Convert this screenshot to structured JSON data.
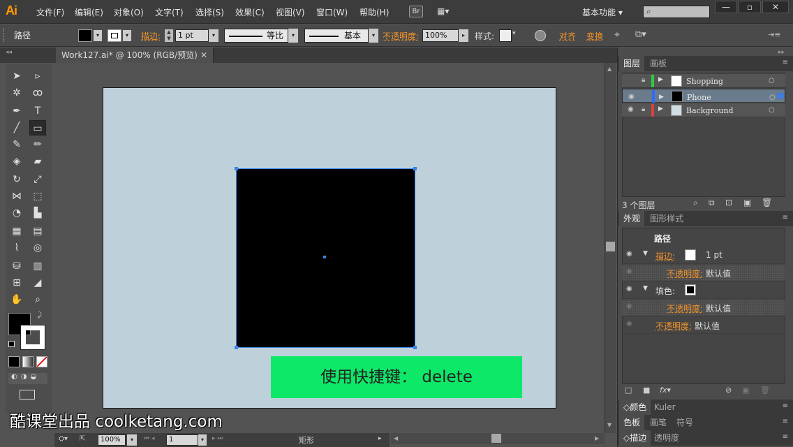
{
  "app": {
    "logo": "Ai",
    "workspace": "基本功能",
    "search_placeholder": ""
  },
  "menu": [
    "文件(F)",
    "编辑(E)",
    "对象(O)",
    "文字(T)",
    "选择(S)",
    "效果(C)",
    "视图(V)",
    "窗口(W)",
    "帮助(H)"
  ],
  "bridge_label": "Br",
  "control": {
    "selection_type": "路径",
    "stroke_label": "描边:",
    "stroke_weight": "1 pt",
    "profile_label": "等比",
    "brush_label": "基本",
    "opacity_label": "不透明度:",
    "opacity_value": "100%",
    "style_label": "样式:",
    "align_label": "对齐",
    "transform_label": "变换"
  },
  "document": {
    "tab_title": "Work127.ai* @ 100% (RGB/预览)"
  },
  "canvas": {
    "shortcut_text": "使用快捷键： delete",
    "watermark": "酷课堂出品 coolketang.com"
  },
  "status": {
    "zoom": "100%",
    "artboard": "1",
    "tool": "矩形"
  },
  "layers_panel": {
    "tab_layers": "图层",
    "tab_artboards": "画板",
    "layers": [
      {
        "name": "Shopping",
        "color": "#2ecc40"
      },
      {
        "name": "Phone",
        "color": "#2f6bff"
      },
      {
        "name": "Background",
        "color": "#e04040"
      }
    ],
    "count": "3 个图层"
  },
  "appearance_panel": {
    "tab_appearance": "外观",
    "tab_graphic_styles": "图形样式",
    "object": "路径",
    "stroke_label": "描边:",
    "stroke_weight": "1 pt",
    "opacity_label": "不透明度:",
    "default": "默认值",
    "fill_label": "填色:",
    "opacity_label2": "不透明度:",
    "default2": "默认值",
    "default3": "默认值"
  },
  "collapsed_panels": {
    "color": "颜色",
    "kuler": "Kuler",
    "swatches": "色板",
    "brushes": "画笔",
    "symbols": "符号",
    "stroke": "描边",
    "transparency": "透明度"
  },
  "colors": {
    "artboard": "#bed1da",
    "shortcut_bg": "#0de868",
    "accent": "#f0922a",
    "selection": "#3b83e6"
  }
}
